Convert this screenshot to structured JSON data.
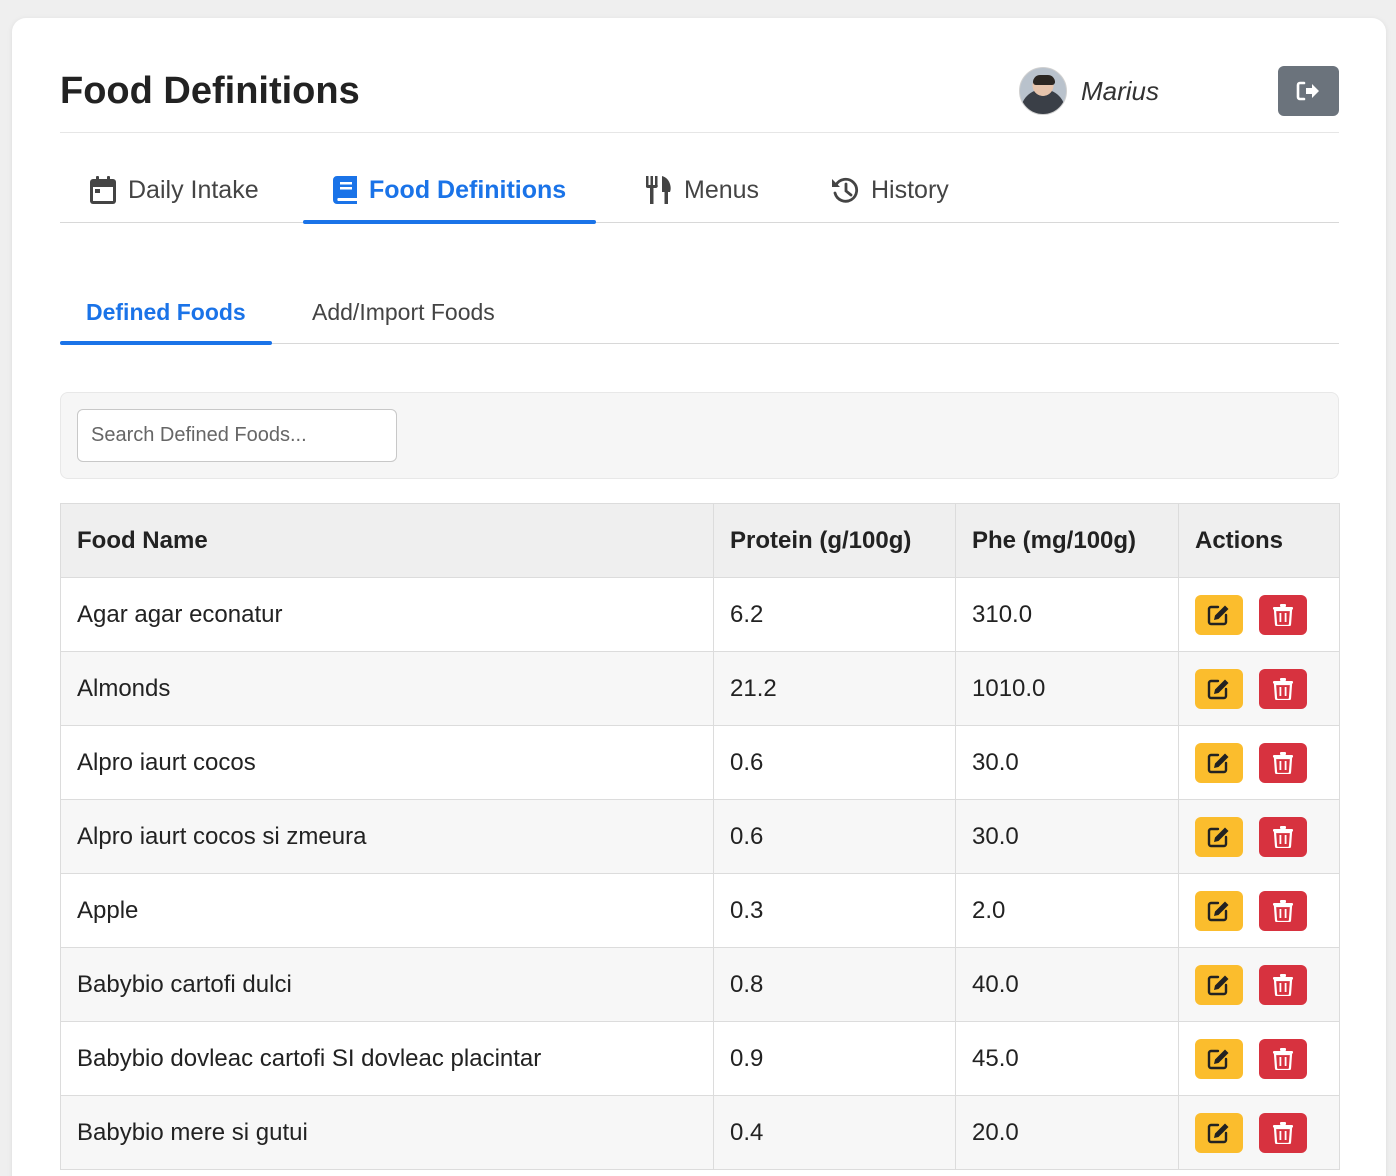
{
  "header": {
    "title": "Food Definitions",
    "username": "Marius",
    "logout_icon": "sign-out-icon"
  },
  "main_nav": {
    "tabs": [
      {
        "label": "Daily Intake",
        "icon": "calendar-icon",
        "active": false
      },
      {
        "label": "Food Definitions",
        "icon": "book-icon",
        "active": true
      },
      {
        "label": "Menus",
        "icon": "utensils-icon",
        "active": false
      },
      {
        "label": "History",
        "icon": "history-icon",
        "active": false
      }
    ]
  },
  "sub_nav": {
    "tabs": [
      {
        "label": "Defined Foods",
        "active": true
      },
      {
        "label": "Add/Import Foods",
        "active": false
      }
    ]
  },
  "search": {
    "placeholder": "Search Defined Foods...",
    "value": ""
  },
  "table": {
    "headers": [
      "Food Name",
      "Protein (g/100g)",
      "Phe (mg/100g)",
      "Actions"
    ],
    "rows": [
      {
        "name": "Agar agar econatur",
        "protein": "6.2",
        "phe": "310.0"
      },
      {
        "name": "Almonds",
        "protein": "21.2",
        "phe": "1010.0"
      },
      {
        "name": "Alpro iaurt cocos",
        "protein": "0.6",
        "phe": "30.0"
      },
      {
        "name": "Alpro iaurt cocos si zmeura",
        "protein": "0.6",
        "phe": "30.0"
      },
      {
        "name": "Apple",
        "protein": "0.3",
        "phe": "2.0"
      },
      {
        "name": "Babybio cartofi dulci",
        "protein": "0.8",
        "phe": "40.0"
      },
      {
        "name": "Babybio dovleac cartofi SI dovleac placintar",
        "protein": "0.9",
        "phe": "45.0"
      },
      {
        "name": "Babybio mere si gutui",
        "protein": "0.4",
        "phe": "20.0"
      }
    ]
  },
  "colors": {
    "accent": "#1a73e8",
    "edit": "#fbbd2d",
    "delete": "#d7323f",
    "logout": "#6b737c"
  }
}
